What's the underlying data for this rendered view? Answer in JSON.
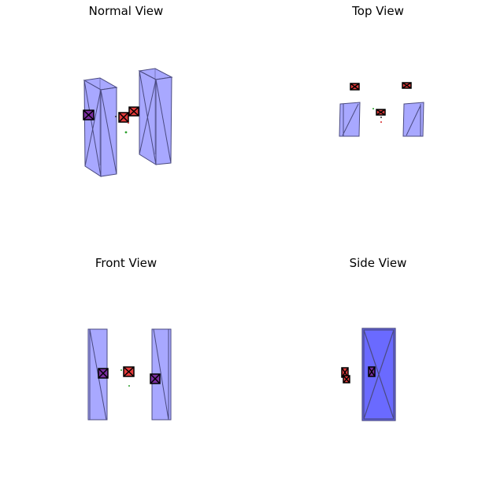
{
  "colors": {
    "box_fill": "#9999ff",
    "box_fill_dense": "#6262ff",
    "box_edge": "#4a4a80",
    "marker_fill": "#e23b3b",
    "marker_purple": "#7a2ea0",
    "marker_edge": "#000000",
    "dot_green": "#2ca02c",
    "dot_red": "#d62728",
    "dot_dark": "#333333"
  },
  "panels": [
    {
      "key": "normal",
      "title": "Normal View"
    },
    {
      "key": "top",
      "title": "Top View"
    },
    {
      "key": "front",
      "title": "Front View"
    },
    {
      "key": "side",
      "title": "Side View"
    }
  ]
}
